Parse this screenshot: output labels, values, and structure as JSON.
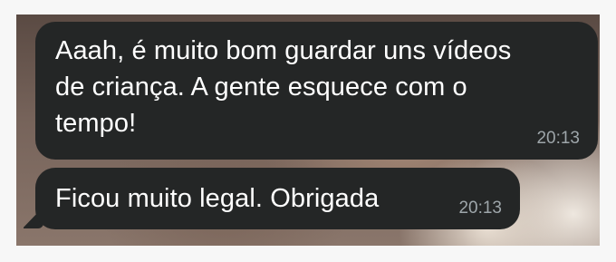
{
  "messages": [
    {
      "text": "Aaah, é muito bom guardar uns vídeos\nde criança. A gente esquece com o\ntempo!",
      "time": "20:13"
    },
    {
      "text": "Ficou muito legal. Obrigada",
      "time": "20:13"
    }
  ],
  "colors": {
    "bubble": "#242626",
    "text": "#ffffff",
    "timestamp": "#9ea6aa"
  }
}
